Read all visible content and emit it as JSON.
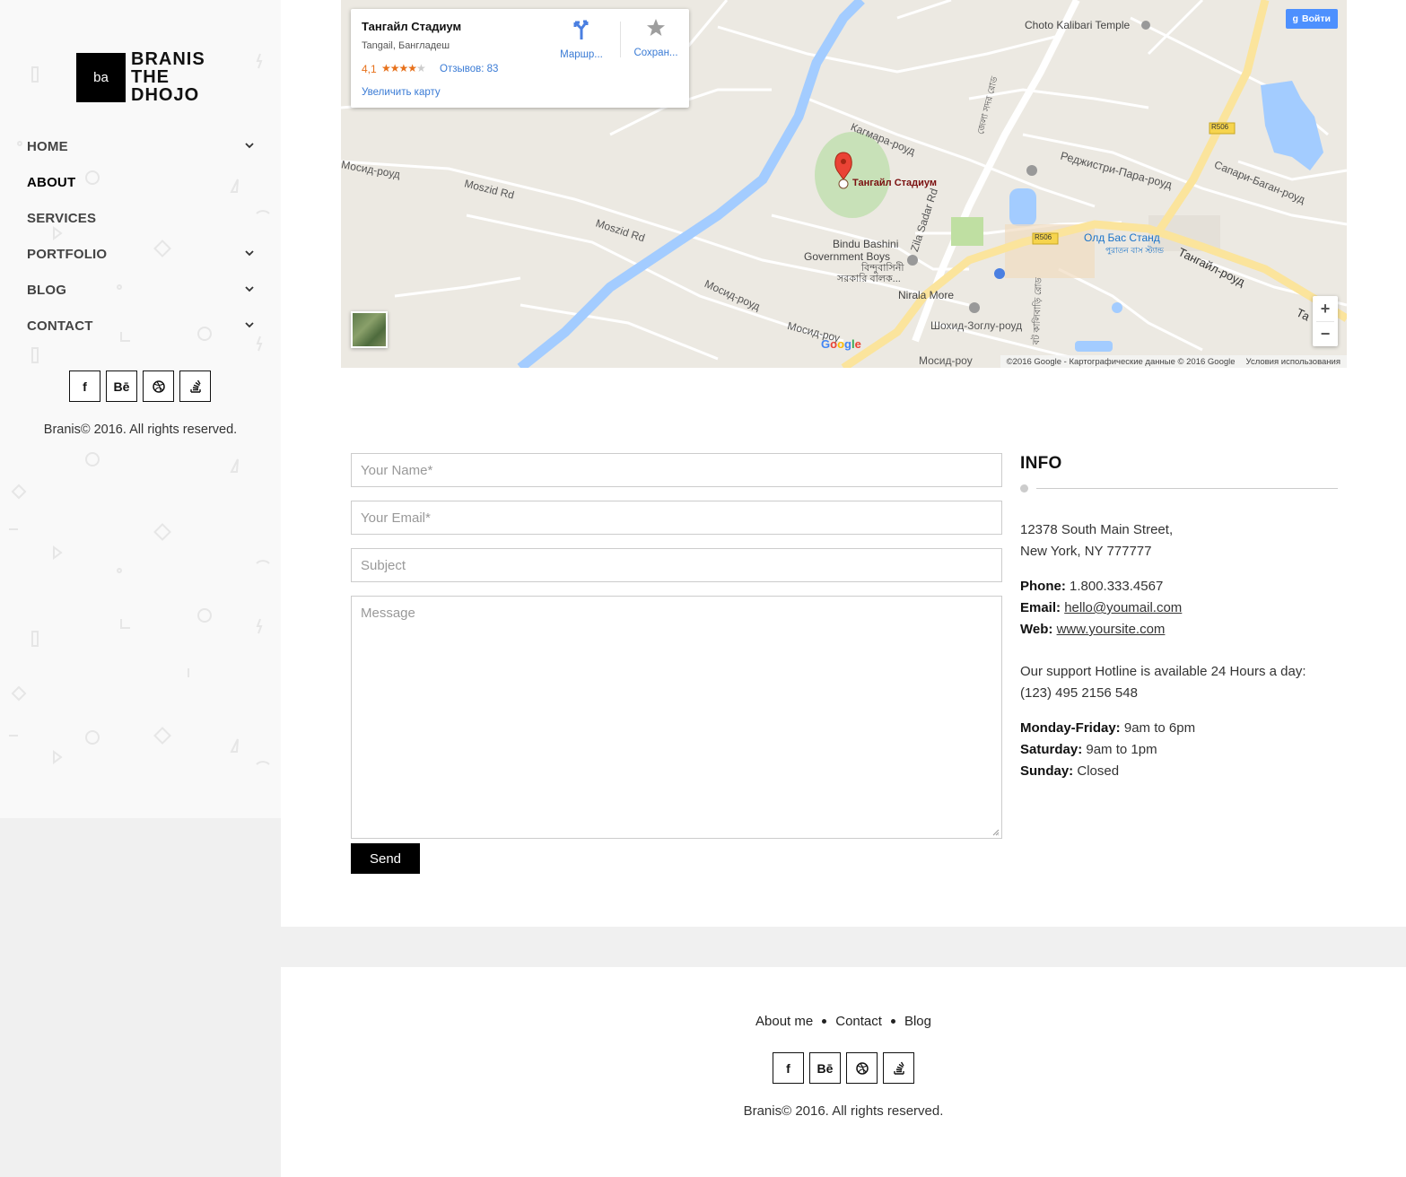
{
  "brand": {
    "mark": "ba",
    "line1": "BRANIS",
    "line2": "THE",
    "line3": "DHOJO"
  },
  "nav": [
    {
      "label": "HOME",
      "has_children": true
    },
    {
      "label": "ABOUT",
      "has_children": false,
      "active": true
    },
    {
      "label": "SERVICES",
      "has_children": false
    },
    {
      "label": "PORTFOLIO",
      "has_children": true
    },
    {
      "label": "BLOG",
      "has_children": true
    },
    {
      "label": "CONTACT",
      "has_children": true
    }
  ],
  "social": {
    "facebook": "f",
    "behance": "Bē",
    "dribbble": "dribbble-icon",
    "stack": "stack-icon"
  },
  "sidebar": {
    "copyright": "Branis© 2016. All rights reserved."
  },
  "map": {
    "place": {
      "name": "Тангайл Стадиум",
      "address": "Tangail, Бангладеш",
      "rating": "4,1",
      "stars": 4,
      "reviews": "Отзывов: 83",
      "enlarge": "Увеличить карту",
      "route": "Маршр...",
      "save": "Сохран..."
    },
    "signin": "Войти",
    "attribution": "©2016 Google - Картографические данные © 2016 Google",
    "terms": "Условия использования",
    "labels": {
      "temple": "Choto Kalibari Temple",
      "stadium": "Тангайл Стадиум",
      "kagmara": "Кагмара-роуд",
      "registry": "Реджистри-Пара-роуд",
      "sapari": "Сапари-Баган-роуд",
      "mosid_road_1": "Мосид-роуд",
      "moszid_rd_1": "Moszid Rd",
      "moszid_rd_2": "Moszid Rd",
      "mosid_road_2": "Мосид-роуд",
      "mosid_road_3": "Мосид-роу",
      "mosid_road_4": "Мосид-роу",
      "bindu_1": "Bindu Bashini",
      "bindu_2": "Government Boys",
      "bindu_bn_1": "বিন্দুবাসিনী",
      "bindu_bn_2": "সরকারি বালক...",
      "nirala": "Nirala More",
      "zila_sadar": "Zila Sadar Rd",
      "bus_stand": "Олд Бас Станд",
      "bus_stand_bn": "পুরাতন বাস স্ট্যান্ড",
      "tangail_road": "Тангайл-роуд",
      "tangail_road_short": "Та",
      "shohid": "Шохид-Зоглу-роуд",
      "r506_1": "R506",
      "r506_2": "R506",
      "bn_road_1": "জেলা সদর রোড",
      "bn_road_2": "বট কালিবাড়ি রোড"
    },
    "google": "Google",
    "zoom_in": "+",
    "zoom_out": "−"
  },
  "form": {
    "name_placeholder": "Your Name*",
    "email_placeholder": "Your Email*",
    "subject_placeholder": "Subject",
    "message_placeholder": "Message",
    "send": "Send"
  },
  "info": {
    "title": "INFO",
    "address1": "12378 South Main Street,",
    "address2": "New York, NY 777777",
    "phone_label": "Phone:",
    "phone": "1.800.333.4567",
    "email_label": "Email:",
    "email": "hello@youmail.com",
    "web_label": "Web:",
    "web": "www.yoursite.com",
    "hotline1": "Our support Hotline is available 24 Hours a day:",
    "hotline2": "(123) 495 2156 548",
    "mf_label": "Monday-Friday:",
    "mf": "9am to 6pm",
    "sat_label": "Saturday:",
    "sat": "9am to 1pm",
    "sun_label": "Sunday:",
    "sun": "Closed"
  },
  "footer": {
    "links": [
      "About me",
      "Contact",
      "Blog"
    ],
    "copyright": "Branis© 2016. All rights reserved."
  }
}
